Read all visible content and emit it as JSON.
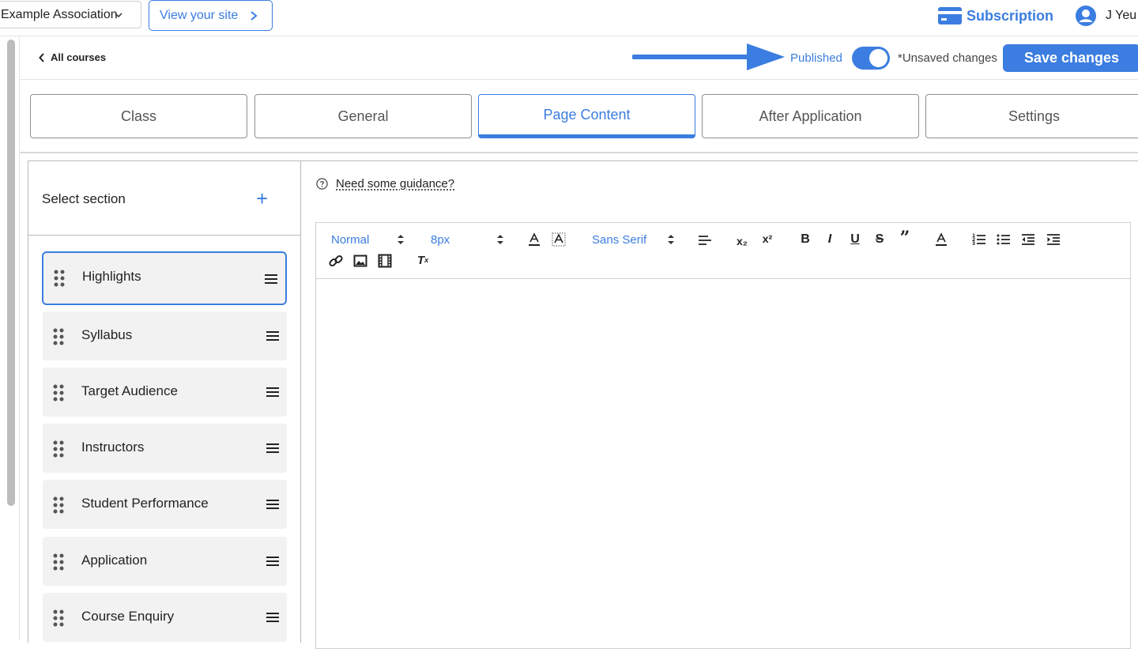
{
  "topbar": {
    "org_name": "Example Association",
    "view_site_label": "View your site",
    "subscription_label": "Subscription",
    "user_name": "J Yeu",
    "accent": "#3b7de0"
  },
  "header": {
    "back_label": "All courses",
    "published_label": "Published",
    "published": true,
    "unsaved_label": "*Unsaved changes",
    "save_label": "Save changes"
  },
  "tabs": [
    {
      "label": "Class",
      "active": false
    },
    {
      "label": "General",
      "active": false
    },
    {
      "label": "Page Content",
      "active": true
    },
    {
      "label": "After Application",
      "active": false
    },
    {
      "label": "Settings",
      "active": false
    }
  ],
  "sections": {
    "title": "Select section",
    "add_icon": "plus-icon",
    "items": [
      {
        "label": "Highlights",
        "active": true
      },
      {
        "label": "Syllabus",
        "active": false
      },
      {
        "label": "Target Audience",
        "active": false
      },
      {
        "label": "Instructors",
        "active": false
      },
      {
        "label": "Student Performance",
        "active": false
      },
      {
        "label": "Application",
        "active": false
      },
      {
        "label": "Course Enquiry",
        "active": false
      }
    ]
  },
  "editor": {
    "guidance_label": "Need some guidance?",
    "format_value": "Normal",
    "size_value": "8px",
    "font_value": "Sans Serif"
  }
}
